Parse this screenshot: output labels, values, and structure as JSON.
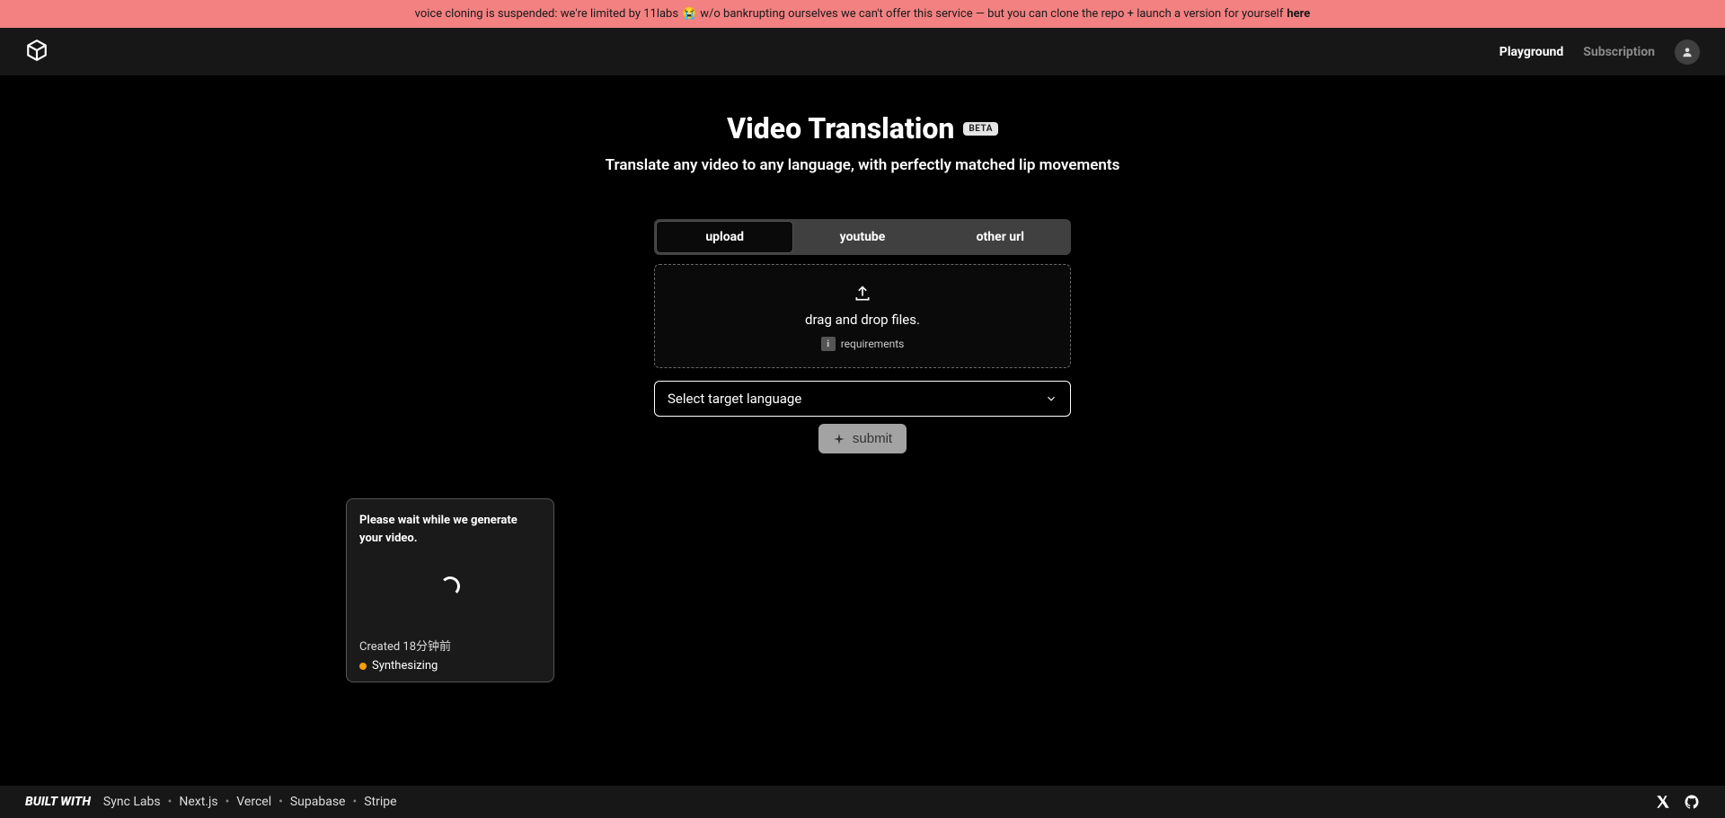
{
  "banner": {
    "text_before": "voice cloning is suspended: we're limited by 11labs",
    "emoji": "😭",
    "text_after": "w/o bankrupting ourselves we can't offer this service — but you can clone the repo + launch a version for yourself",
    "link_text": "here"
  },
  "nav": {
    "playground": "Playground",
    "subscription": "Subscription"
  },
  "header": {
    "title": "Video Translation",
    "badge": "BETA",
    "subtitle": "Translate any video to any language, with perfectly matched lip movements"
  },
  "tabs": {
    "upload": "upload",
    "youtube": "youtube",
    "other": "other url"
  },
  "dropzone": {
    "text": "drag and drop files.",
    "requirements": "requirements",
    "info_char": "i"
  },
  "select": {
    "placeholder": "Select target language"
  },
  "submit": "submit",
  "job": {
    "message": "Please wait while we generate your video.",
    "created_prefix": "Created ",
    "created_time": "18分钟前",
    "status": "Synthesizing"
  },
  "footer": {
    "built_with": "BUILT WITH",
    "links": [
      "Sync Labs",
      "Next.js",
      "Vercel",
      "Supabase",
      "Stripe"
    ]
  }
}
